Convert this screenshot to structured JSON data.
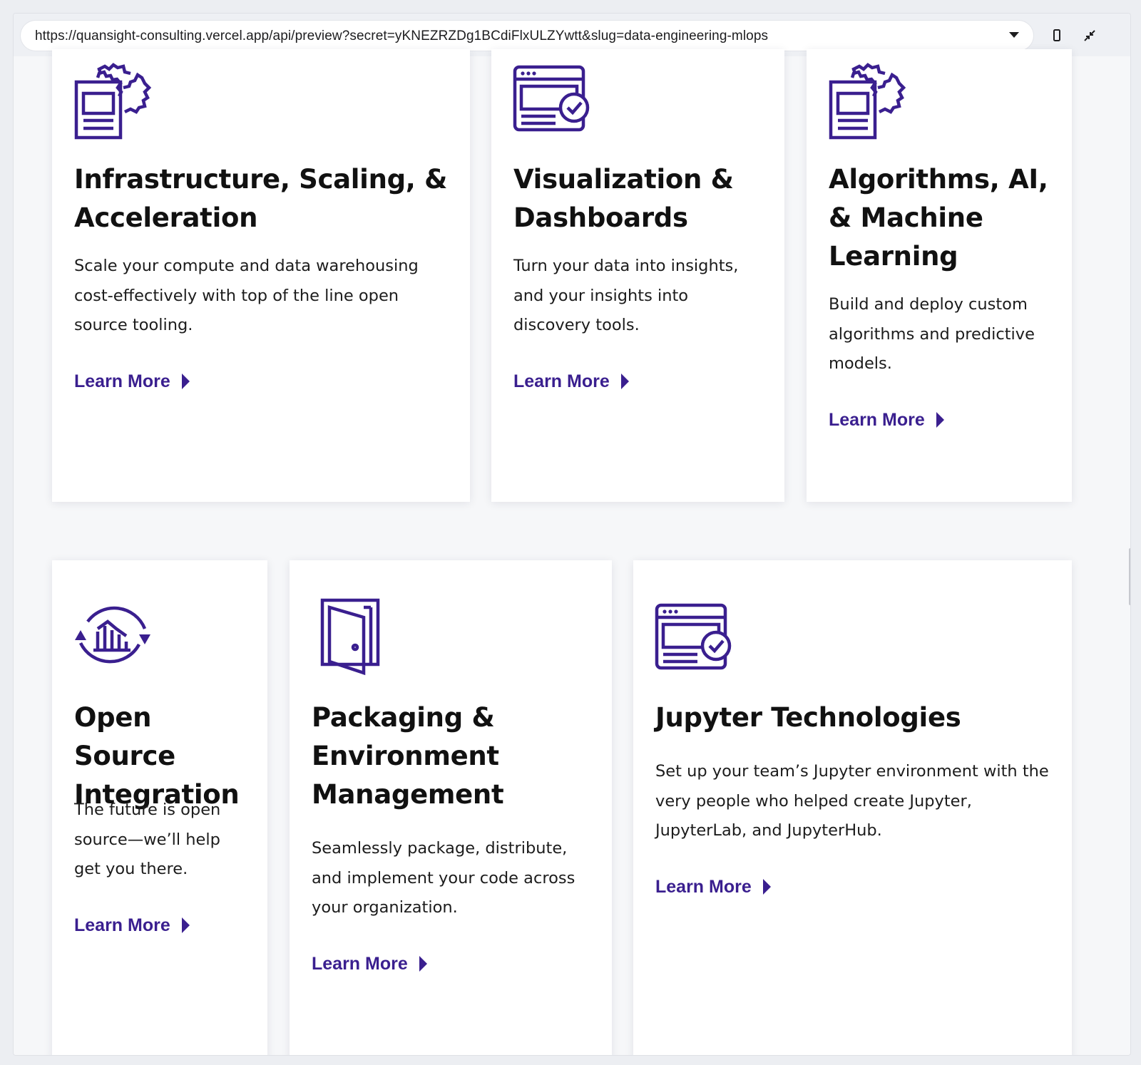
{
  "browser": {
    "url": "https://quansight-consulting.vercel.app/api/preview?secret=yKNEZRZDg1BCdiFlxULZYwtt&slug=data-engineering-mlops",
    "icons": [
      "dropdown-caret-icon",
      "mobile-device-icon",
      "collapse-arrows-icon"
    ]
  },
  "accent_color": "#3a1f8f",
  "cards": [
    {
      "icon": "document-gear-icon",
      "title": "Infrastructure, Scaling, & Acceleration",
      "description": "Scale your compute and data warehousing cost-effectively with top of the line open source tooling.",
      "link": "Learn More"
    },
    {
      "icon": "browser-check-icon",
      "title": "Visualization & Dashboards",
      "description": "Turn your data into insights, and your insights into discovery tools.",
      "link": "Learn More"
    },
    {
      "icon": "document-gear-icon",
      "title": "Algorithms, AI, & Machine Learning",
      "description": "Build and deploy custom algorithms and predictive models.",
      "link": "Learn More"
    },
    {
      "icon": "cycle-chart-icon",
      "title": "Open Source Integration",
      "description": "The future is open source—we’ll help get you there.",
      "link": "Learn More"
    },
    {
      "icon": "open-door-icon",
      "title": "Packaging & Environment Management",
      "description": "Seamlessly package, distribute, and implement your code across your organization.",
      "link": "Learn More"
    },
    {
      "icon": "browser-check-icon",
      "title": "Jupyter Technologies",
      "description": "Set up your team’s Jupyter environment with the very people who helped create Jupyter, JupyterLab, and JupyterHub.",
      "link": "Learn More"
    }
  ]
}
